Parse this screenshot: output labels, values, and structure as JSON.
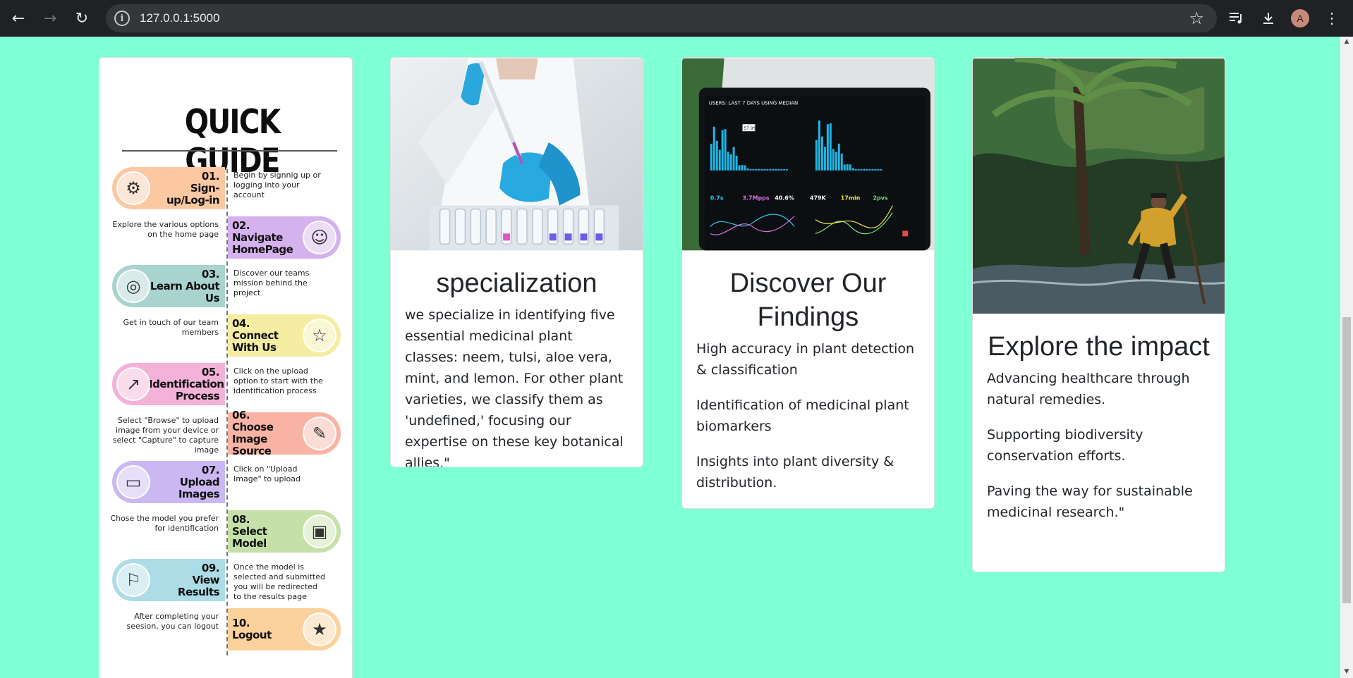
{
  "browser": {
    "url": "127.0.0.1:5000",
    "profile_initial": "A"
  },
  "guide": {
    "title": "QUICK GUIDE",
    "steps": [
      {
        "num": "01.",
        "label": "Sign-up/Log-in",
        "desc": "Begin by signnig up or logging into your account",
        "color": "#fbc8a2",
        "icon": "lightbulb-gear-icon"
      },
      {
        "num": "02.",
        "label": "Navigate HomePage",
        "desc": "Explore the various options on the home page",
        "color": "#d5b1ee",
        "icon": "head-brain-icon"
      },
      {
        "num": "03.",
        "label": "Learn About Us",
        "desc": "Discover our teams mission behind the project",
        "color": "#a9d3cf",
        "icon": "target-icon"
      },
      {
        "num": "04.",
        "label": "Connect With Us",
        "desc": "Get in touch of our team members",
        "color": "#f4eda2",
        "icon": "hand-star-icon"
      },
      {
        "num": "05.",
        "label": "Identification Process",
        "desc": "Click on the upload option to start with the identification process",
        "color": "#f3b2d8",
        "icon": "chart-icon"
      },
      {
        "num": "06.",
        "label": "Choose Image Source",
        "desc": "Select \"Browse\" to upload image from your device or select \"Capture\" to capture image",
        "color": "#f9b3a4",
        "icon": "document-search-icon"
      },
      {
        "num": "07.",
        "label": "Upload Images",
        "desc": "Click on \"Upload Image\" to upload",
        "color": "#cbb8f2",
        "icon": "monitor-icon"
      },
      {
        "num": "08.",
        "label": "Select Model",
        "desc": "Chose the model you prefer for identification",
        "color": "#c5e0a8",
        "icon": "briefcase-icon"
      },
      {
        "num": "09.",
        "label": "View Results",
        "desc": "Once the model is selected and submitted you will be redirected to the results page",
        "color": "#acdce6",
        "icon": "megaphone-icon"
      },
      {
        "num": "10.",
        "label": "Logout",
        "desc": "After completing your seesion, you can logout",
        "color": "#fbd19c",
        "icon": "trophy-icon"
      }
    ]
  },
  "cards": [
    {
      "title": "specialization",
      "paragraphs": [
        "we specialize in identifying five essential medicinal plant classes: neem, tulsi, aloe vera, mint, and lemon. For other plant varieties, we classify them as 'undefined,' focusing our expertise on these key botanical allies.\""
      ]
    },
    {
      "title": "Discover Our Findings",
      "paragraphs": [
        "High accuracy in plant detection & classification",
        "Identification of medicinal plant biomarkers",
        "Insights into plant diversity & distribution."
      ]
    },
    {
      "title": "Explore the impact",
      "paragraphs": [
        "Advancing healthcare through natural remedies.",
        "Supporting biodiversity conservation efforts.",
        "Paving the way for sustainable medicinal research.\""
      ]
    }
  ],
  "dashboard": {
    "header": "USERS: LAST 7 DAYS USING MEDIAN",
    "stats": [
      "0.7s",
      "3.7Mpps",
      "40.6%",
      "479K",
      "17min",
      "2pvs"
    ],
    "callout": "57.9%"
  }
}
